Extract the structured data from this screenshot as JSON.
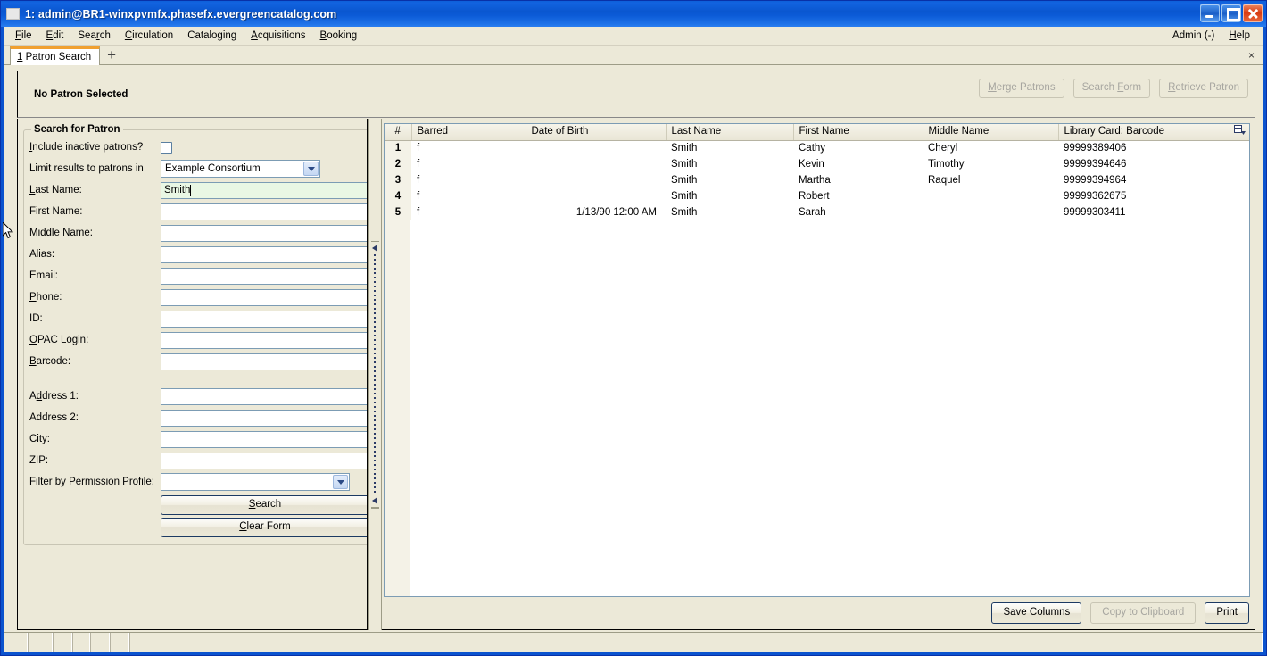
{
  "window": {
    "title": "1: admin@BR1-winxpvmfx.phasefx.evergreencatalog.com",
    "minimize_label": "Minimize",
    "maximize_label": "Maximize",
    "close_label": "Close"
  },
  "menubar": {
    "items": [
      {
        "label": "File",
        "accel": "F"
      },
      {
        "label": "Edit",
        "accel": "E"
      },
      {
        "label": "Search",
        "accel": "r"
      },
      {
        "label": "Circulation",
        "accel": "C"
      },
      {
        "label": "Cataloging",
        "accel": ""
      },
      {
        "label": "Acquisitions",
        "accel": "A"
      },
      {
        "label": "Booking",
        "accel": "B"
      }
    ],
    "right_items": [
      {
        "label": "Admin (-)",
        "accel": ""
      },
      {
        "label": "Help",
        "accel": "H"
      }
    ]
  },
  "tabs": {
    "items": [
      {
        "number": "1",
        "label": "Patron Search"
      }
    ],
    "add_label": "+",
    "close_label": "×"
  },
  "patron_bar": {
    "status": "No Patron Selected",
    "buttons": [
      {
        "label": "Merge Patrons",
        "enabled": false
      },
      {
        "label": "Search Form",
        "enabled": false
      },
      {
        "label": "Retrieve Patron",
        "enabled": false
      }
    ]
  },
  "search_form": {
    "legend": "Search for Patron",
    "include_inactive": {
      "label": "Include inactive patrons?",
      "checked": false
    },
    "limit_results": {
      "label": "Limit results to patrons in",
      "value": "Example Consortium",
      "options": [
        "Example Consortium"
      ]
    },
    "fields": [
      {
        "label": "Last Name:",
        "value": "Smith",
        "focused": true
      },
      {
        "label": "First Name:",
        "value": "",
        "focused": false
      },
      {
        "label": "Middle Name:",
        "value": "",
        "focused": false
      },
      {
        "label": "Alias:",
        "value": "",
        "focused": false
      },
      {
        "label": "Email:",
        "value": "",
        "focused": false
      },
      {
        "label": "Phone:",
        "value": "",
        "focused": false
      },
      {
        "label": "ID:",
        "value": "",
        "focused": false
      },
      {
        "label": "OPAC Login:",
        "value": "",
        "focused": false
      },
      {
        "label": "Barcode:",
        "value": "",
        "focused": false
      }
    ],
    "address_fields": [
      {
        "label": "Address 1:",
        "value": ""
      },
      {
        "label": "Address 2:",
        "value": ""
      },
      {
        "label": "City:",
        "value": ""
      },
      {
        "label": "ZIP:",
        "value": ""
      }
    ],
    "permission_profile": {
      "label": "Filter by Permission Profile:",
      "value": "",
      "options": []
    },
    "search_button": "Search",
    "clear_button": "Clear Form"
  },
  "results": {
    "columns": [
      {
        "key": "num",
        "label": "#"
      },
      {
        "key": "barred",
        "label": "Barred"
      },
      {
        "key": "dob",
        "label": "Date of Birth"
      },
      {
        "key": "last",
        "label": "Last Name"
      },
      {
        "key": "first",
        "label": "First Name"
      },
      {
        "key": "middle",
        "label": "Middle Name"
      },
      {
        "key": "card",
        "label": "Library Card: Barcode"
      }
    ],
    "rows": [
      {
        "num": "1",
        "barred": "f",
        "dob": "",
        "last": "Smith",
        "first": "Cathy",
        "middle": "Cheryl",
        "card": "99999389406"
      },
      {
        "num": "2",
        "barred": "f",
        "dob": "",
        "last": "Smith",
        "first": "Kevin",
        "middle": "Timothy",
        "card": "99999394646"
      },
      {
        "num": "3",
        "barred": "f",
        "dob": "",
        "last": "Smith",
        "first": "Martha",
        "middle": "Raquel",
        "card": "99999394964"
      },
      {
        "num": "4",
        "barred": "f",
        "dob": "",
        "last": "Smith",
        "first": "Robert",
        "middle": "",
        "card": "99999362675"
      },
      {
        "num": "5",
        "barred": "f",
        "dob": "1/13/90 12:00 AM",
        "last": "Smith",
        "first": "Sarah",
        "middle": "",
        "card": "99999303411"
      }
    ],
    "column_picker_icon": "column-picker-icon",
    "buttons": [
      {
        "label": "Save Columns",
        "enabled": true
      },
      {
        "label": "Copy to Clipboard",
        "enabled": false
      },
      {
        "label": "Print",
        "enabled": true
      }
    ]
  },
  "statusbar": {
    "segments": [
      "",
      "",
      "",
      "",
      "",
      "",
      ""
    ]
  },
  "colors": {
    "titlebar_blue": "#0b53ce",
    "chrome": "#ece9d8",
    "tab_accent": "#f0a030",
    "field_focus_green": "#e9f7e4",
    "field_border": "#7c9cb4"
  }
}
